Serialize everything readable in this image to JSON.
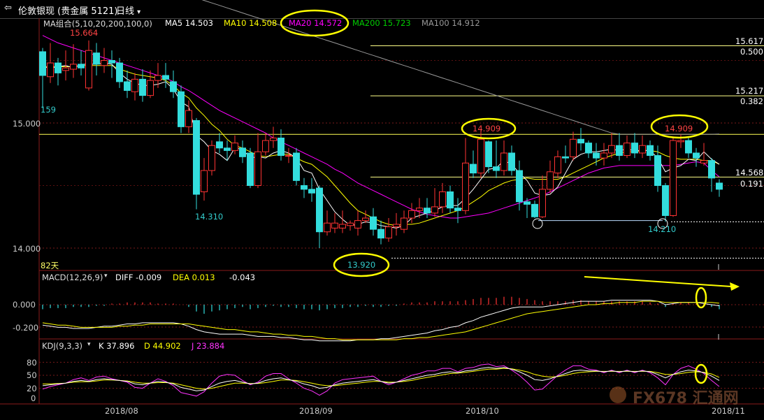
{
  "window": {
    "menu_icon": "back-arrow-icon",
    "title": "伦敦银现 (贵金属 5121)",
    "period": "日线"
  },
  "price_panel": {
    "ma_group": "MA组合(5,10,20,200,100,0)",
    "ma_legend": [
      {
        "label": "MA5 14.503",
        "color": "#ffffff"
      },
      {
        "label": "MA10 14.508",
        "color": "#ffff00"
      },
      {
        "label": "MA20 14.572",
        "color": "#ff00ff"
      },
      {
        "label": "MA200 15.723",
        "color": "#00cc00"
      },
      {
        "label": "MA100 14.912",
        "color": "#999999"
      }
    ],
    "y_ticks": [
      "15.000",
      "14.000"
    ],
    "price_labels": [
      "15.664",
      "159",
      "14.310",
      "13.920",
      "14.909",
      "14.909",
      "14.210"
    ],
    "fib_levels": [
      {
        "price": "15.617",
        "ratio": "0.500"
      },
      {
        "price": "15.217",
        "ratio": "0.382"
      },
      {
        "price": "14.568",
        "ratio": "0.191"
      }
    ],
    "days_label": "82天"
  },
  "macd_panel": {
    "name": "MACD(12,26,9)",
    "diff": "DIFF -0.009",
    "dea": "DEA 0.013",
    "macd": "-0.043",
    "y_ticks": [
      "0.000",
      "-0.200"
    ]
  },
  "kdj_panel": {
    "name": "KDJ(9,3,3)",
    "k": "K 37.896",
    "d": "D 44.902",
    "j": "J 23.884",
    "y_ticks": [
      "80",
      "50",
      "20",
      "0"
    ]
  },
  "x_labels": [
    "2018/08",
    "2018/09",
    "2018/10",
    "2018/11"
  ],
  "watermark": "FX678 汇通网",
  "chart_data": {
    "type": "candlestick",
    "y_range": [
      13.9,
      15.9
    ],
    "candles": [
      [
        15.57,
        15.38,
        15.6,
        15.12
      ],
      [
        15.37,
        15.48,
        15.64,
        15.32
      ],
      [
        15.48,
        15.4,
        15.52,
        15.3
      ],
      [
        15.42,
        15.44,
        15.58,
        15.34
      ],
      [
        15.43,
        15.47,
        15.63,
        15.36
      ],
      [
        15.47,
        15.44,
        15.58,
        15.38
      ],
      [
        15.28,
        15.58,
        15.66,
        15.26
      ],
      [
        15.56,
        15.47,
        15.64,
        15.38
      ],
      [
        15.46,
        15.5,
        15.6,
        15.4
      ],
      [
        15.5,
        15.48,
        15.58,
        15.36
      ],
      [
        15.48,
        15.33,
        15.52,
        15.28
      ],
      [
        15.33,
        15.26,
        15.42,
        15.2
      ],
      [
        15.25,
        15.35,
        15.4,
        15.18
      ],
      [
        15.35,
        15.22,
        15.43,
        15.17
      ],
      [
        15.22,
        15.34,
        15.42,
        15.2
      ],
      [
        15.34,
        15.38,
        15.48,
        15.28
      ],
      [
        15.38,
        15.35,
        15.48,
        15.28
      ],
      [
        15.33,
        15.25,
        15.42,
        15.2
      ],
      [
        15.25,
        14.97,
        15.3,
        14.92
      ],
      [
        14.97,
        15.1,
        15.18,
        14.92
      ],
      [
        15.02,
        14.43,
        15.04,
        14.31
      ],
      [
        14.45,
        14.62,
        14.72,
        14.38
      ],
      [
        14.62,
        14.82,
        14.86,
        14.58
      ],
      [
        14.85,
        14.8,
        14.92,
        14.76
      ],
      [
        14.8,
        14.78,
        14.86,
        14.7
      ],
      [
        14.78,
        14.84,
        14.9,
        14.75
      ],
      [
        14.8,
        14.73,
        14.86,
        14.68
      ],
      [
        14.76,
        14.5,
        14.8,
        14.48
      ],
      [
        14.5,
        14.77,
        14.92,
        14.48
      ],
      [
        14.77,
        14.86,
        14.92,
        14.74
      ],
      [
        14.86,
        14.88,
        14.97,
        14.8
      ],
      [
        14.88,
        14.74,
        14.95,
        14.7
      ],
      [
        14.74,
        14.74,
        14.8,
        14.68
      ],
      [
        14.76,
        14.54,
        14.8,
        14.5
      ],
      [
        14.5,
        14.47,
        14.56,
        14.4
      ],
      [
        14.47,
        14.44,
        14.56,
        14.37
      ],
      [
        14.48,
        14.13,
        14.5,
        14.0
      ],
      [
        14.13,
        14.2,
        14.3,
        14.1
      ],
      [
        14.16,
        14.2,
        14.28,
        14.12
      ],
      [
        14.16,
        14.19,
        14.3,
        14.12
      ],
      [
        14.18,
        14.2,
        14.22,
        14.14
      ],
      [
        14.16,
        14.22,
        14.3,
        14.1
      ],
      [
        14.22,
        14.24,
        14.3,
        14.2
      ],
      [
        14.25,
        14.15,
        14.32,
        14.1
      ],
      [
        14.15,
        14.08,
        14.22,
        14.03
      ],
      [
        14.08,
        14.17,
        14.24,
        14.05
      ],
      [
        14.17,
        14.19,
        14.28,
        14.1
      ],
      [
        14.15,
        14.24,
        14.3,
        14.12
      ],
      [
        14.24,
        14.3,
        14.36,
        14.2
      ],
      [
        14.3,
        14.32,
        14.4,
        14.24
      ],
      [
        14.32,
        14.28,
        14.4,
        14.24
      ],
      [
        14.28,
        14.33,
        14.48,
        14.25
      ],
      [
        14.33,
        14.45,
        14.52,
        14.28
      ],
      [
        14.45,
        14.32,
        14.5,
        14.28
      ],
      [
        14.32,
        14.3,
        14.4,
        14.2
      ],
      [
        14.3,
        14.68,
        14.88,
        14.27
      ],
      [
        14.67,
        14.6,
        14.78,
        14.56
      ],
      [
        14.6,
        14.87,
        14.94,
        14.56
      ],
      [
        14.85,
        14.65,
        14.86,
        14.6
      ],
      [
        14.65,
        14.62,
        14.86,
        14.56
      ],
      [
        14.62,
        14.76,
        14.86,
        14.58
      ],
      [
        14.76,
        14.62,
        14.82,
        14.58
      ],
      [
        14.62,
        14.37,
        14.7,
        14.3
      ],
      [
        14.37,
        14.35,
        14.4,
        14.24
      ],
      [
        14.35,
        14.25,
        14.38,
        14.24
      ],
      [
        14.25,
        14.47,
        14.58,
        14.24
      ],
      [
        14.47,
        14.61,
        14.7,
        14.44
      ],
      [
        14.6,
        14.73,
        14.78,
        14.56
      ],
      [
        14.73,
        14.72,
        14.82,
        14.68
      ],
      [
        14.73,
        14.87,
        14.93,
        14.7
      ],
      [
        14.87,
        14.84,
        14.96,
        14.78
      ],
      [
        14.84,
        14.76,
        14.86,
        14.72
      ],
      [
        14.76,
        14.72,
        14.84,
        14.66
      ],
      [
        14.72,
        14.76,
        14.84,
        14.66
      ],
      [
        14.76,
        14.82,
        14.92,
        14.72
      ],
      [
        14.82,
        14.74,
        14.92,
        14.7
      ],
      [
        14.74,
        14.84,
        14.9,
        14.72
      ],
      [
        14.84,
        14.76,
        14.92,
        14.72
      ],
      [
        14.76,
        14.82,
        14.9,
        14.72
      ],
      [
        14.82,
        14.74,
        14.86,
        14.7
      ],
      [
        14.74,
        14.5,
        14.82,
        14.45
      ],
      [
        14.5,
        14.26,
        14.52,
        14.21
      ],
      [
        14.26,
        14.86,
        14.88,
        14.25
      ],
      [
        14.85,
        14.86,
        14.909,
        14.8
      ],
      [
        14.86,
        14.76,
        14.88,
        14.72
      ],
      [
        14.76,
        14.72,
        14.8,
        14.65
      ],
      [
        14.68,
        14.7,
        14.84,
        14.66
      ],
      [
        14.7,
        14.56,
        14.72,
        14.45
      ],
      [
        14.52,
        14.47,
        14.55,
        14.41
      ]
    ],
    "ma5": [
      15.45,
      15.44,
      15.45,
      15.46,
      15.44,
      15.47,
      15.47,
      15.47,
      15.48,
      15.47,
      15.4,
      15.35,
      15.32,
      15.3,
      15.3,
      15.31,
      15.33,
      15.27,
      15.17,
      15.13,
      14.9,
      14.85,
      14.78,
      14.75,
      14.7,
      14.8,
      14.79,
      14.72,
      14.73,
      14.72,
      14.76,
      14.78,
      14.76,
      14.72,
      14.62,
      14.6,
      14.47,
      14.38,
      14.29,
      14.23,
      14.18,
      14.19,
      14.21,
      14.2,
      14.18,
      14.17,
      14.16,
      14.18,
      14.24,
      14.26,
      14.28,
      14.3,
      14.33,
      14.34,
      14.34,
      14.4,
      14.47,
      14.55,
      14.63,
      14.64,
      14.7,
      14.67,
      14.6,
      14.54,
      14.44,
      14.42,
      14.43,
      14.49,
      14.6,
      14.71,
      14.75,
      14.77,
      14.77,
      14.78,
      14.79,
      14.78,
      14.79,
      14.78,
      14.78,
      14.78,
      14.72,
      14.61,
      14.64,
      14.66,
      14.71,
      14.7,
      14.77,
      14.71,
      14.67
    ],
    "ma10": [
      15.45,
      15.45,
      15.45,
      15.45,
      15.45,
      15.46,
      15.46,
      15.46,
      15.46,
      15.46,
      15.43,
      15.41,
      15.39,
      15.38,
      15.37,
      15.36,
      15.34,
      15.3,
      15.24,
      15.2,
      15.12,
      15.06,
      14.99,
      14.94,
      14.87,
      14.82,
      14.8,
      14.77,
      14.74,
      14.73,
      14.74,
      14.75,
      14.75,
      14.72,
      14.69,
      14.67,
      14.62,
      14.57,
      14.5,
      14.43,
      14.36,
      14.3,
      14.27,
      14.24,
      14.21,
      14.19,
      14.18,
      14.19,
      14.19,
      14.2,
      14.22,
      14.24,
      14.26,
      14.28,
      14.3,
      14.33,
      14.37,
      14.41,
      14.46,
      14.49,
      14.52,
      14.54,
      14.55,
      14.56,
      14.55,
      14.55,
      14.55,
      14.55,
      14.57,
      14.6,
      14.63,
      14.66,
      14.69,
      14.72,
      14.74,
      14.76,
      14.77,
      14.77,
      14.78,
      14.78,
      14.77,
      14.74,
      14.72,
      14.71,
      14.71,
      14.71,
      14.7,
      14.7,
      14.67
    ],
    "ma20": [
      15.7,
      15.67,
      15.64,
      15.62,
      15.6,
      15.58,
      15.56,
      15.54,
      15.52,
      15.5,
      15.48,
      15.46,
      15.44,
      15.42,
      15.4,
      15.38,
      15.36,
      15.33,
      15.29,
      15.26,
      15.22,
      15.18,
      15.14,
      15.1,
      15.07,
      15.04,
      15.01,
      14.98,
      14.95,
      14.92,
      14.88,
      14.85,
      14.82,
      14.79,
      14.76,
      14.73,
      14.7,
      14.67,
      14.63,
      14.6,
      14.56,
      14.52,
      14.49,
      14.46,
      14.43,
      14.4,
      14.37,
      14.34,
      14.31,
      14.29,
      14.27,
      14.26,
      14.25,
      14.24,
      14.24,
      14.25,
      14.26,
      14.27,
      14.28,
      14.3,
      14.32,
      14.34,
      14.36,
      14.38,
      14.4,
      14.42,
      14.45,
      14.48,
      14.51,
      14.54,
      14.57,
      14.6,
      14.62,
      14.64,
      14.65,
      14.66,
      14.66,
      14.66,
      14.66,
      14.66,
      14.66,
      14.66,
      14.66,
      14.67,
      14.68,
      14.69,
      14.68,
      14.62,
      14.57
    ],
    "ma100": [
      16.4,
      16.38,
      16.36,
      16.34,
      16.32,
      16.3,
      16.28,
      16.26,
      16.24,
      16.22,
      16.2,
      16.18,
      16.16,
      16.14,
      16.12,
      16.1,
      16.08,
      16.06,
      16.04,
      16.02,
      16.0,
      15.98,
      15.96,
      15.94,
      15.92,
      15.9,
      15.88,
      15.86,
      15.84,
      15.82,
      15.8,
      15.78,
      15.76,
      15.74,
      15.72,
      15.7,
      15.68,
      15.66,
      15.64,
      15.62,
      15.6,
      15.58,
      15.56,
      15.54,
      15.52,
      15.5,
      15.48,
      15.46,
      15.44,
      15.42,
      15.4,
      15.38,
      15.36,
      15.34,
      15.32,
      15.3,
      15.28,
      15.26,
      15.24,
      15.22,
      15.2,
      15.18,
      15.16,
      15.14,
      15.12,
      15.1,
      15.08,
      15.06,
      15.04,
      15.02,
      15.0,
      14.98,
      14.96,
      14.94,
      14.92,
      14.91,
      14.91,
      14.91,
      14.91,
      14.91,
      14.91,
      14.91,
      14.91,
      14.91,
      14.91,
      14.91,
      14.91,
      14.91,
      14.912
    ],
    "macd_hist": [
      -0.04,
      -0.03,
      -0.03,
      -0.03,
      -0.02,
      -0.02,
      -0.02,
      -0.01,
      -0.01,
      0.01,
      0.01,
      0.02,
      0.02,
      0.02,
      0.02,
      0.01,
      0.01,
      0.01,
      0.0,
      -0.02,
      -0.06,
      -0.08,
      -0.06,
      -0.05,
      -0.04,
      -0.03,
      -0.02,
      -0.04,
      -0.03,
      -0.02,
      -0.01,
      -0.02,
      -0.02,
      -0.03,
      -0.04,
      -0.04,
      -0.05,
      -0.04,
      -0.03,
      -0.03,
      -0.02,
      -0.02,
      -0.01,
      -0.02,
      -0.02,
      -0.01,
      -0.01,
      0.01,
      0.02,
      0.02,
      0.02,
      0.03,
      0.03,
      0.03,
      0.03,
      0.04,
      0.05,
      0.06,
      0.06,
      0.06,
      0.07,
      0.07,
      0.06,
      0.05,
      0.04,
      0.03,
      0.03,
      0.03,
      0.03,
      0.04,
      0.04,
      0.03,
      0.03,
      0.03,
      0.03,
      0.03,
      0.03,
      0.03,
      0.03,
      0.02,
      0.01,
      -0.02,
      0.01,
      0.02,
      0.02,
      0.01,
      0.01,
      -0.02,
      -0.04
    ],
    "diff": [
      -0.18,
      -0.19,
      -0.2,
      -0.2,
      -0.21,
      -0.21,
      -0.21,
      -0.2,
      -0.19,
      -0.19,
      -0.18,
      -0.17,
      -0.17,
      -0.16,
      -0.16,
      -0.16,
      -0.16,
      -0.16,
      -0.17,
      -0.19,
      -0.22,
      -0.24,
      -0.25,
      -0.26,
      -0.26,
      -0.26,
      -0.26,
      -0.27,
      -0.28,
      -0.28,
      -0.28,
      -0.29,
      -0.29,
      -0.3,
      -0.31,
      -0.31,
      -0.32,
      -0.32,
      -0.32,
      -0.32,
      -0.32,
      -0.31,
      -0.31,
      -0.31,
      -0.3,
      -0.3,
      -0.29,
      -0.28,
      -0.27,
      -0.26,
      -0.25,
      -0.23,
      -0.22,
      -0.2,
      -0.19,
      -0.16,
      -0.14,
      -0.11,
      -0.09,
      -0.07,
      -0.05,
      -0.03,
      -0.02,
      -0.02,
      -0.02,
      -0.02,
      -0.01,
      0.0,
      0.01,
      0.02,
      0.03,
      0.03,
      0.03,
      0.03,
      0.04,
      0.04,
      0.04,
      0.04,
      0.04,
      0.04,
      0.03,
      0.0,
      0.01,
      0.02,
      0.02,
      0.02,
      0.01,
      0.0,
      -0.01
    ],
    "dea": [
      -0.16,
      -0.17,
      -0.18,
      -0.18,
      -0.19,
      -0.2,
      -0.2,
      -0.2,
      -0.2,
      -0.2,
      -0.19,
      -0.19,
      -0.18,
      -0.18,
      -0.17,
      -0.17,
      -0.17,
      -0.17,
      -0.17,
      -0.17,
      -0.18,
      -0.19,
      -0.2,
      -0.21,
      -0.22,
      -0.22,
      -0.23,
      -0.24,
      -0.24,
      -0.25,
      -0.26,
      -0.26,
      -0.27,
      -0.27,
      -0.28,
      -0.28,
      -0.29,
      -0.3,
      -0.3,
      -0.31,
      -0.31,
      -0.31,
      -0.31,
      -0.31,
      -0.31,
      -0.31,
      -0.31,
      -0.3,
      -0.3,
      -0.29,
      -0.29,
      -0.28,
      -0.27,
      -0.26,
      -0.25,
      -0.24,
      -0.22,
      -0.2,
      -0.18,
      -0.16,
      -0.14,
      -0.12,
      -0.1,
      -0.08,
      -0.07,
      -0.06,
      -0.05,
      -0.04,
      -0.03,
      -0.02,
      -0.01,
      0.0,
      0.0,
      0.01,
      0.01,
      0.02,
      0.02,
      0.02,
      0.03,
      0.03,
      0.03,
      0.02,
      0.02,
      0.02,
      0.02,
      0.02,
      0.02,
      0.02,
      0.013
    ],
    "kdj_k": [
      26,
      28,
      30,
      32,
      36,
      38,
      36,
      40,
      42,
      40,
      38,
      36,
      30,
      28,
      32,
      36,
      34,
      30,
      22,
      18,
      14,
      16,
      24,
      32,
      36,
      38,
      34,
      30,
      32,
      38,
      42,
      44,
      40,
      36,
      30,
      26,
      20,
      22,
      28,
      32,
      34,
      36,
      38,
      40,
      36,
      32,
      34,
      38,
      42,
      46,
      50,
      52,
      56,
      58,
      56,
      60,
      62,
      66,
      68,
      66,
      68,
      64,
      58,
      50,
      40,
      38,
      42,
      48,
      54,
      60,
      62,
      60,
      60,
      58,
      60,
      58,
      60,
      58,
      60,
      58,
      52,
      44,
      52,
      58,
      62,
      60,
      56,
      48,
      38
    ],
    "kdj_d": [
      30,
      30,
      31,
      32,
      34,
      35,
      35,
      37,
      39,
      39,
      38,
      37,
      34,
      32,
      32,
      33,
      33,
      32,
      28,
      24,
      20,
      18,
      20,
      24,
      28,
      32,
      32,
      31,
      31,
      33,
      36,
      39,
      39,
      38,
      35,
      32,
      28,
      26,
      26,
      28,
      30,
      32,
      34,
      36,
      36,
      34,
      34,
      36,
      38,
      42,
      45,
      48,
      51,
      54,
      55,
      57,
      59,
      62,
      64,
      64,
      66,
      65,
      62,
      58,
      52,
      48,
      46,
      47,
      50,
      54,
      57,
      58,
      59,
      59,
      59,
      59,
      59,
      59,
      59,
      59,
      56,
      52,
      52,
      54,
      57,
      58,
      57,
      53,
      45
    ],
    "kdj_j": [
      18,
      24,
      28,
      32,
      40,
      44,
      38,
      46,
      48,
      42,
      38,
      34,
      22,
      20,
      32,
      42,
      36,
      26,
      10,
      6,
      2,
      12,
      32,
      48,
      52,
      50,
      38,
      28,
      34,
      48,
      54,
      54,
      42,
      32,
      20,
      14,
      4,
      14,
      32,
      40,
      42,
      44,
      46,
      48,
      36,
      28,
      34,
      42,
      50,
      54,
      60,
      60,
      66,
      66,
      58,
      66,
      68,
      74,
      76,
      70,
      72,
      62,
      50,
      34,
      16,
      18,
      34,
      50,
      62,
      72,
      72,
      64,
      62,
      56,
      62,
      56,
      62,
      56,
      62,
      56,
      44,
      28,
      52,
      66,
      72,
      64,
      54,
      38,
      24
    ]
  }
}
